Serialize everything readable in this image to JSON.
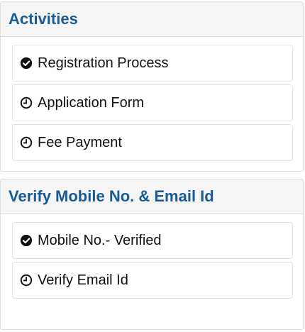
{
  "activities": {
    "title": "Activities",
    "items": [
      {
        "label": "Registration Process",
        "icon": "check-circle-icon",
        "status": "done"
      },
      {
        "label": "Application Form",
        "icon": "clock-icon",
        "status": "pending"
      },
      {
        "label": "Fee Payment",
        "icon": "clock-icon",
        "status": "pending"
      }
    ]
  },
  "verify": {
    "title": "Verify Mobile No. & Email Id",
    "items": [
      {
        "label": "Mobile No.- Verified",
        "icon": "check-circle-icon",
        "status": "done"
      },
      {
        "label": "Verify Email Id",
        "icon": "clock-icon",
        "status": "pending"
      }
    ]
  },
  "colors": {
    "heading": "#1a5a96",
    "panel_header_bg": "#f5f5f5",
    "border": "#dddddd"
  }
}
